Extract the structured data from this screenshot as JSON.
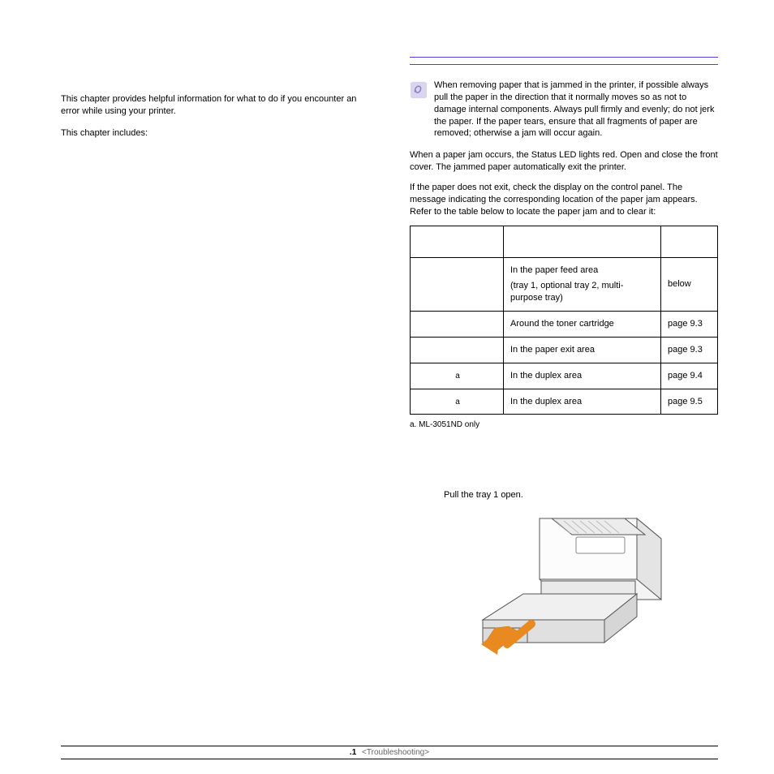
{
  "left": {
    "intro": "This chapter provides helpful information for what to do if you encounter an error while using your printer.",
    "includes": "This chapter includes:"
  },
  "right": {
    "note": "When removing paper that is jammed in the printer, if possible always pull the paper in the direction that it normally moves so as not to damage internal components. Always pull firmly and evenly; do not jerk the paper. If the paper tears, ensure that all fragments of paper are removed; otherwise a jam will occur again.",
    "para1": "When a paper jam occurs, the Status LED lights red. Open and close the front cover. The jammed paper automatically exit the printer.",
    "para2": "If the paper does not exit, check the display on the control panel. The message indicating the corresponding location of the paper jam appears. Refer to the table below to locate the paper jam and to clear it:"
  },
  "table": {
    "head": {
      "msg": "",
      "loc": "",
      "go": ""
    },
    "rows": [
      {
        "msg": "",
        "loc_main": "In the paper feed area",
        "loc_sub": "(tray 1, optional tray 2, multi-purpose tray)",
        "go": "below"
      },
      {
        "msg": "",
        "loc_main": "Around the toner cartridge",
        "loc_sub": "",
        "go": "page 9.3"
      },
      {
        "msg": "",
        "loc_main": "In the paper exit area",
        "loc_sub": "",
        "go": "page 9.3"
      },
      {
        "msg": "",
        "sup": "a",
        "loc_main": "In the duplex area",
        "loc_sub": "",
        "go": "page 9.4"
      },
      {
        "msg": "",
        "sup": "a",
        "loc_main": "In the duplex area",
        "loc_sub": "",
        "go": "page 9.5"
      }
    ],
    "footnote": "a. ML-3051ND only"
  },
  "step": "Pull the tray 1 open.",
  "footer": {
    "page": ".1",
    "chapter": "<Troubleshooting>"
  }
}
